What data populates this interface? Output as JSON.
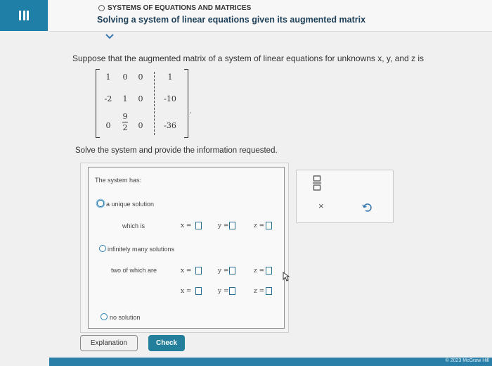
{
  "header": {
    "subtitle": "SYSTEMS OF EQUATIONS AND MATRICES",
    "title": "Solving a system of linear equations given its augmented matrix"
  },
  "problem": {
    "text": "Suppose that the augmented matrix of a system of linear equations for unknowns x, y, and z is",
    "matrix": {
      "row1": [
        "1",
        "0",
        "0",
        "1"
      ],
      "row2": [
        "-2",
        "1",
        "0",
        "-10"
      ],
      "row3_a": "0",
      "row3_b_num": "9",
      "row3_b_den": "2",
      "row3_c": "0",
      "row3_d": "-36"
    },
    "instruction": "Solve the system and provide the information requested."
  },
  "answer": {
    "heading": "The system has:",
    "opt_unique": "a unique solution",
    "which_is": "which is",
    "opt_infinite": "infinitely many solutions",
    "two_of_which": "two of which are",
    "opt_none": "no solution",
    "var_x": "x =",
    "var_y": "y =",
    "var_z": "z ="
  },
  "tools": {
    "close_symbol": "×"
  },
  "buttons": {
    "explanation": "Explanation",
    "check": "Check"
  },
  "footer": {
    "copyright": "© 2023 McGraw Hill"
  },
  "colors": {
    "accent": "#1f7fa6",
    "check_button": "#237f9c",
    "title": "#1d3f58"
  }
}
